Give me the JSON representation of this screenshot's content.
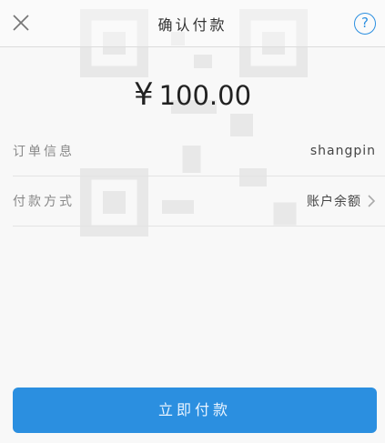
{
  "header": {
    "title": "确认付款",
    "close_icon": "close-icon",
    "help_label": "?"
  },
  "payment": {
    "currency_symbol": "¥",
    "amount": "100.00"
  },
  "order_info": {
    "label": "订单信息",
    "value": "shangpin"
  },
  "payment_method": {
    "label": "付款方式",
    "value": "账户余额",
    "icon": "chevron-right-icon"
  },
  "actions": {
    "pay_label": "立即付款"
  },
  "colors": {
    "accent": "#2b8fe0",
    "background": "#f8f8f8"
  }
}
